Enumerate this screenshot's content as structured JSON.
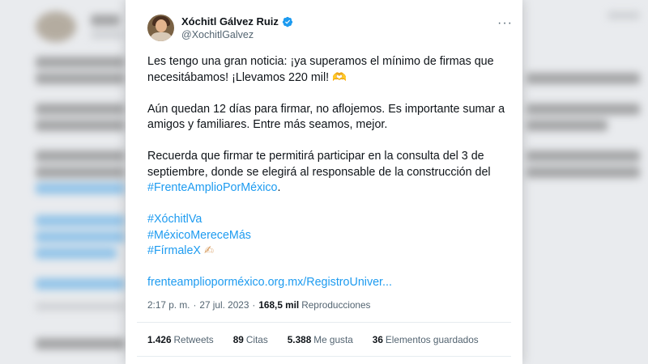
{
  "tweet": {
    "display_name": "Xóchitl Gálvez Ruiz",
    "handle": "@XochitlGalvez",
    "more_icon": "more-icon",
    "paragraphs": {
      "p1": "Les tengo una gran noticia: ¡ya superamos el mínimo de firmas que necesitábamos! ¡Llevamos 220 mil!",
      "p1_emoji": "🫶",
      "p2": "Aún quedan 12 días para firmar, no aflojemos. Es importante sumar a amigos y familiares. Entre más seamos, mejor.",
      "p3": "Recuerda que firmar te permitirá participar en la consulta del 3 de septiembre, donde se elegirá al responsable de la construcción del",
      "p3_hashtag": "#FrenteAmplioPorMéxico",
      "p3_end": "."
    },
    "hashtags": {
      "h1": "#XóchitlVa",
      "h2": "#MéxicoMereceMás",
      "h3": "#FírmaleX",
      "h3_emoji": "✍"
    },
    "link": "frenteamplioporméxico.org.mx/RegistroUniver...",
    "time": "2:17 p. m.",
    "dot": "·",
    "date": "27 jul. 2023",
    "views_count": "168,5 mil",
    "views_label": "Reproducciones",
    "stats": {
      "retweets_count": "1.426",
      "retweets_label": "Retweets",
      "quotes_count": "89",
      "quotes_label": "Citas",
      "likes_count": "5.388",
      "likes_label": "Me gusta",
      "bookmarks_count": "36",
      "bookmarks_label": "Elementos guardados"
    }
  },
  "colors": {
    "link": "#1d9bf0",
    "verified": "#1d9bf0",
    "text": "#0f1419",
    "muted": "#536471"
  }
}
